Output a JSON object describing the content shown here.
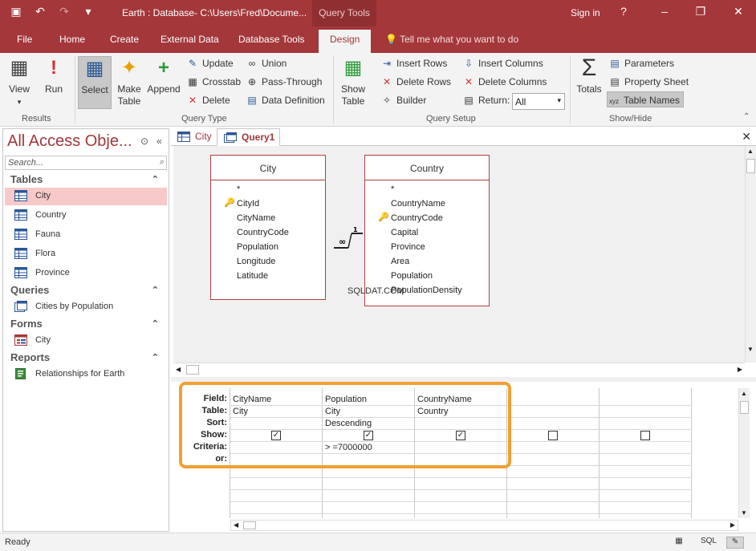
{
  "window": {
    "title": "Earth : Database- C:\\Users\\Fred\\Docume...",
    "context_label": "Query Tools",
    "sign_in": "Sign in",
    "help": "?"
  },
  "tabs": {
    "file": "File",
    "home": "Home",
    "create": "Create",
    "external": "External Data",
    "dbtools": "Database Tools",
    "design": "Design",
    "tell": "Tell me what you want to do"
  },
  "ribbon": {
    "view": "View",
    "run": "Run",
    "select": "Select",
    "make_table_1": "Make",
    "make_table_2": "Table",
    "append": "Append",
    "update": "Update",
    "crosstab": "Crosstab",
    "delete": "Delete",
    "union": "Union",
    "pass_through": "Pass-Through",
    "data_definition": "Data Definition",
    "show_table_1": "Show",
    "show_table_2": "Table",
    "insert_rows": "Insert Rows",
    "delete_rows": "Delete Rows",
    "builder": "Builder",
    "insert_columns": "Insert Columns",
    "delete_columns": "Delete Columns",
    "return_label": "Return:",
    "return_value": "All",
    "totals": "Totals",
    "parameters": "Parameters",
    "property_sheet": "Property Sheet",
    "table_names": "Table Names",
    "groups": {
      "results": "Results",
      "query_type": "Query Type",
      "query_setup": "Query Setup",
      "show_hide": "Show/Hide"
    }
  },
  "nav": {
    "title": "All Access Obje...",
    "search_placeholder": "Search...",
    "tables_header": "Tables",
    "tables": [
      "City",
      "Country",
      "Fauna",
      "Flora",
      "Province"
    ],
    "queries_header": "Queries",
    "queries": [
      "Cities by Population"
    ],
    "forms_header": "Forms",
    "forms": [
      "City"
    ],
    "reports_header": "Reports",
    "reports": [
      "Relationships for Earth"
    ]
  },
  "doctabs": {
    "city": "City",
    "query1": "Query1"
  },
  "diagram": {
    "city": {
      "name": "City",
      "fields": [
        "*",
        "CityId",
        "CityName",
        "CountryCode",
        "Population",
        "Longitude",
        "Latitude"
      ]
    },
    "country": {
      "name": "Country",
      "fields": [
        "*",
        "CountryName",
        "CountryCode",
        "Capital",
        "Province",
        "Area",
        "Population",
        "PopulationDensity"
      ]
    },
    "rel_one": "1",
    "rel_many": "∞",
    "watermark": "SQLDAT.COM"
  },
  "grid": {
    "labels": {
      "field": "Field:",
      "table": "Table:",
      "sort": "Sort:",
      "show": "Show:",
      "criteria": "Criteria:",
      "or": "or:"
    },
    "columns": [
      {
        "field": "CityName",
        "table": "City",
        "sort": "",
        "criteria": "",
        "show": true
      },
      {
        "field": "Population",
        "table": "City",
        "sort": "Descending",
        "criteria": "> =7000000",
        "show": true
      },
      {
        "field": "CountryName",
        "table": "Country",
        "sort": "",
        "criteria": "",
        "show": true
      },
      {
        "field": "",
        "table": "",
        "sort": "",
        "criteria": "",
        "show": false
      },
      {
        "field": "",
        "table": "",
        "sort": "",
        "criteria": "",
        "show": false
      }
    ]
  },
  "status": {
    "text": "Ready",
    "sql_label": "SQL"
  },
  "colors": {
    "accent": "#a4373a",
    "highlight": "#f0a033",
    "selected_nav": "#f8c9c9"
  }
}
